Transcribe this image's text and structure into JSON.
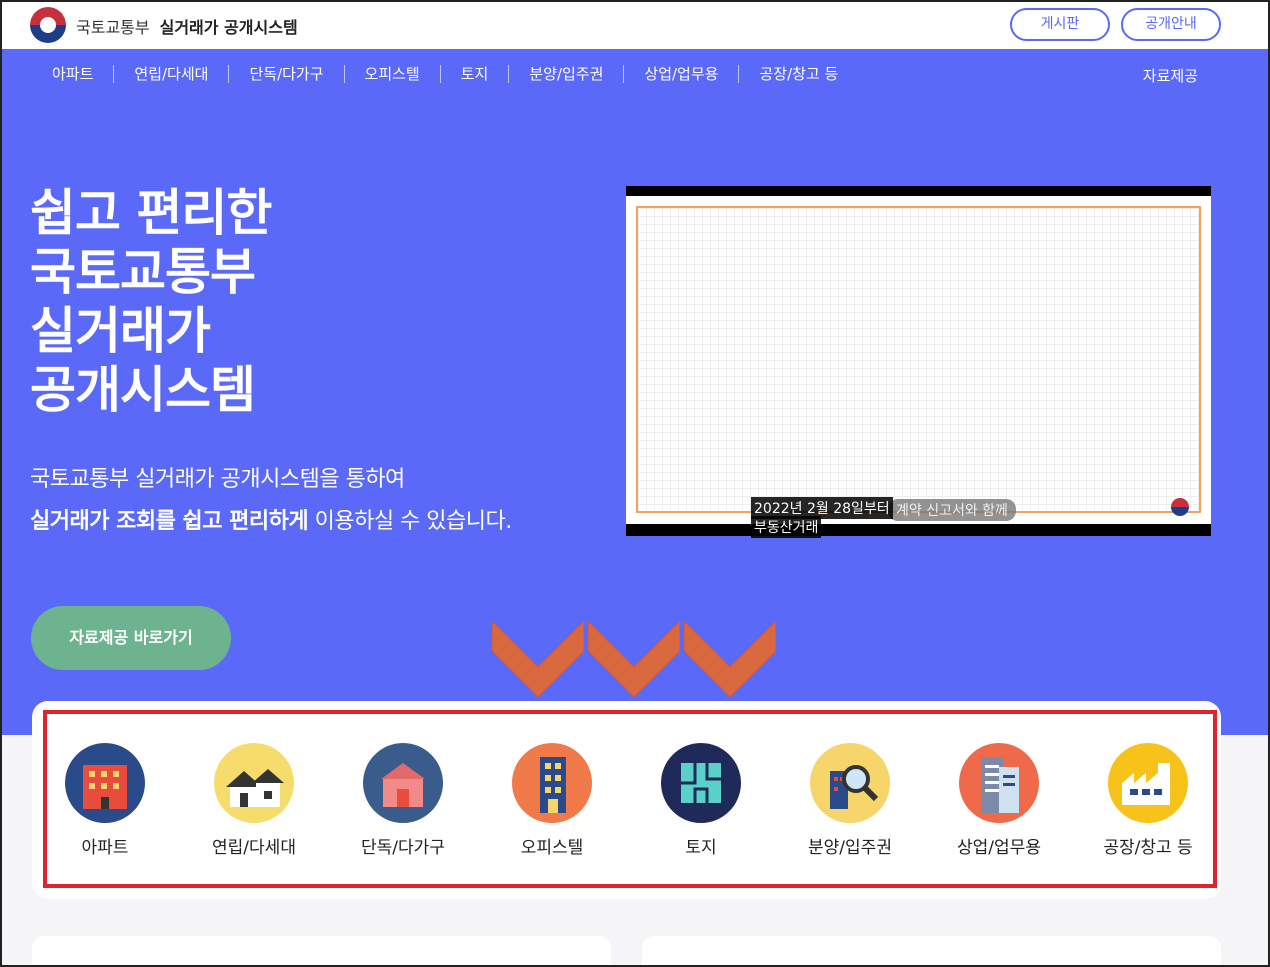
{
  "header": {
    "org": "국토교통부",
    "system": "실거래가 공개시스템",
    "board_btn": "게시판",
    "guide_btn": "공개안내"
  },
  "nav": {
    "items": [
      "아파트",
      "연립/다세대",
      "단독/다가구",
      "오피스텔",
      "토지",
      "분양/입주권",
      "상업/업무용",
      "공장/창고 등"
    ],
    "extra": "자료제공"
  },
  "hero": {
    "title_lines": [
      "쉽고 편리한",
      "국토교통부",
      "실거래가",
      "공개시스템"
    ],
    "sub_line1": "국토교통부 실거래가 공개시스템을 통하여",
    "sub_line2_bold": "실거래가 조회를 쉽고 편리하게",
    "sub_line2_rest": " 이용하실 수 있습니다.",
    "cta": "자료제공 바로가기"
  },
  "video": {
    "caption1": "2022년 2월 28일부터",
    "caption2": "부동산거래",
    "caption3": "계약 신고서와 함께"
  },
  "categories": [
    {
      "label": "아파트",
      "icon": "apartment-icon",
      "color": "#2b4a8a"
    },
    {
      "label": "연립/다세대",
      "icon": "rowhouse-icon",
      "color": "#f6dc6a"
    },
    {
      "label": "단독/다가구",
      "icon": "detached-house-icon",
      "color": "#3a5c8c"
    },
    {
      "label": "오피스텔",
      "icon": "officetel-icon",
      "color": "#f07a4a"
    },
    {
      "label": "토지",
      "icon": "land-icon",
      "color": "#1e2a5a"
    },
    {
      "label": "분양/입주권",
      "icon": "presale-search-icon",
      "color": "#f6d56a"
    },
    {
      "label": "상업/업무용",
      "icon": "commercial-building-icon",
      "color": "#ef6a4a"
    },
    {
      "label": "공장/창고 등",
      "icon": "factory-icon",
      "color": "#f7c21a"
    }
  ]
}
